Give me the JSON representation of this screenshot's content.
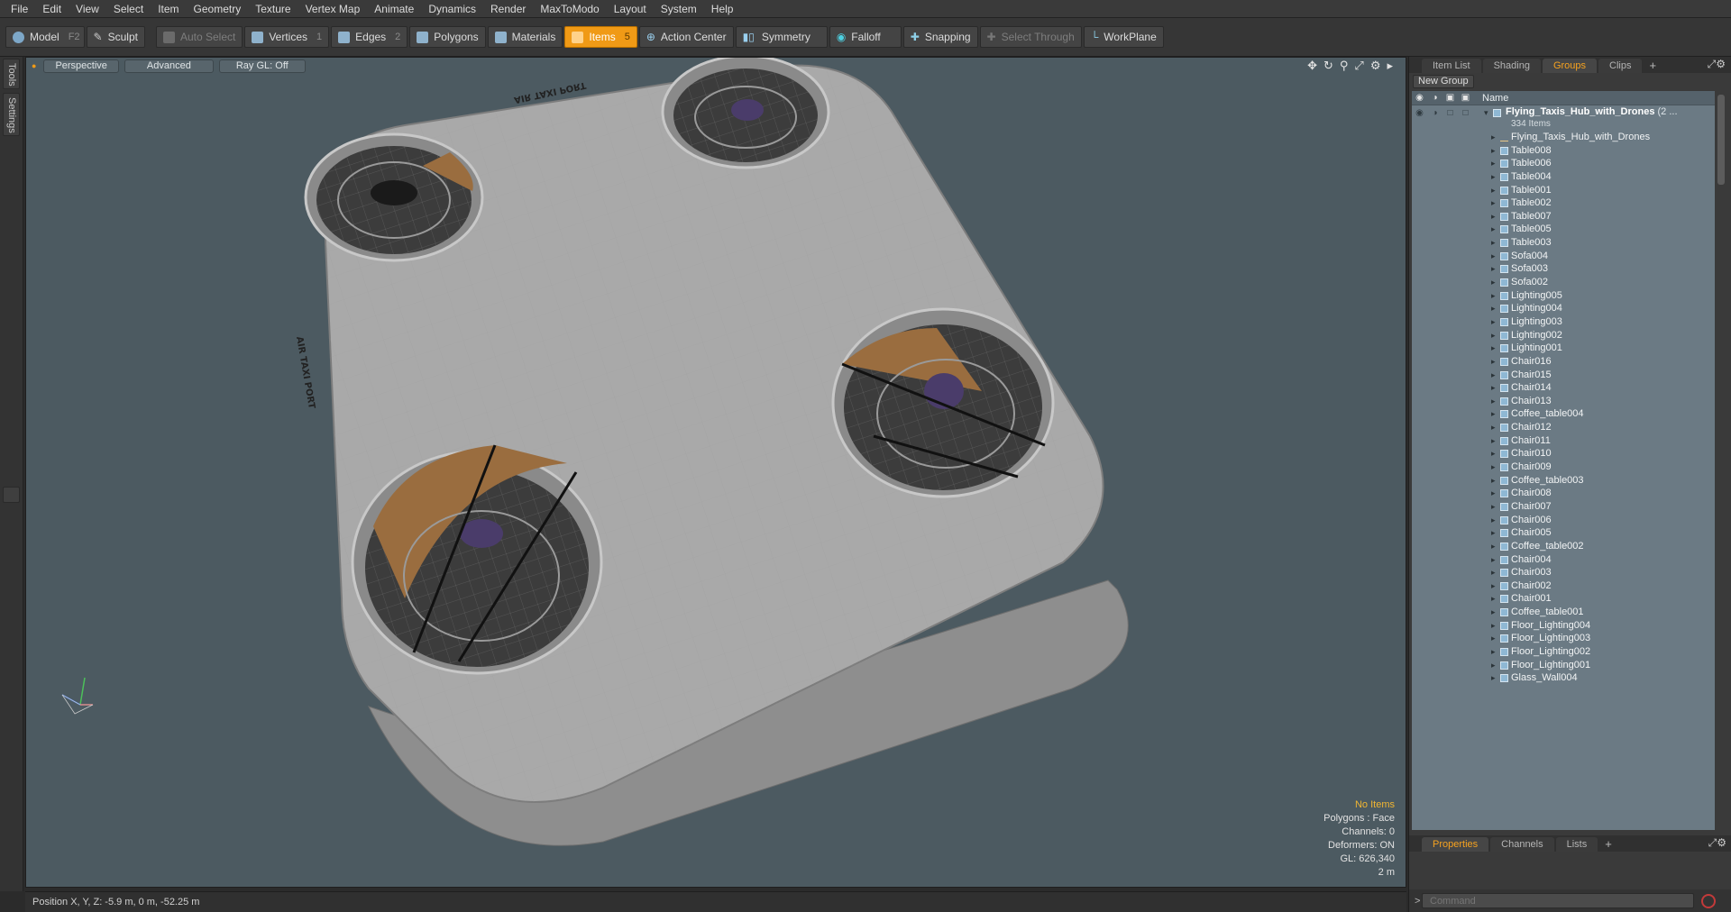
{
  "menu": [
    "File",
    "Edit",
    "View",
    "Select",
    "Item",
    "Geometry",
    "Texture",
    "Vertex Map",
    "Animate",
    "Dynamics",
    "Render",
    "MaxToModo",
    "Layout",
    "System",
    "Help"
  ],
  "toolbar": {
    "model": "Model",
    "model_key": "F2",
    "sculpt": "Sculpt",
    "auto_select": "Auto Select",
    "vertices": "Vertices",
    "vertices_key": "1",
    "edges": "Edges",
    "edges_key": "2",
    "polygons": "Polygons",
    "materials": "Materials",
    "items": "Items",
    "items_key": "5",
    "action_center": "Action Center",
    "symmetry": "Symmetry",
    "falloff": "Falloff",
    "snapping": "Snapping",
    "select_through": "Select Through",
    "workplane": "WorkPlane",
    "accent_color": "#f09a16"
  },
  "left_tabs": [
    "Tools",
    "Settings"
  ],
  "viewport": {
    "perspective": "Perspective",
    "advanced": "Advanced",
    "raygl": "Ray GL: Off",
    "sign_top": "AIR TAXI PORT",
    "sign_left": "AIR TAXI PORT",
    "info": {
      "no_items": "No Items",
      "polygons": "Polygons : Face",
      "channels": "Channels: 0",
      "deformers": "Deformers: ON",
      "gl": "GL: 626,340",
      "scale": "2 m"
    },
    "background_color": "#4c5a61"
  },
  "status": {
    "position": "Position X, Y, Z:  -5.9 m, 0 m, -52.25 m"
  },
  "right_panel": {
    "tabs": [
      "Item List",
      "Shading",
      "Groups",
      "Clips"
    ],
    "active_tab": "Groups",
    "new_group": "New Group",
    "column_name": "Name",
    "group_name": "Flying_Taxis_Hub_with_Drones",
    "group_suffix": "(2 ...",
    "group_count": "334 Items",
    "items": [
      "Flying_Taxis_Hub_with_Drones",
      "Table008",
      "Table006",
      "Table004",
      "Table001",
      "Table002",
      "Table007",
      "Table005",
      "Table003",
      "Sofa004",
      "Sofa003",
      "Sofa002",
      "Lighting005",
      "Lighting004",
      "Lighting003",
      "Lighting002",
      "Lighting001",
      "Chair016",
      "Chair015",
      "Chair014",
      "Chair013",
      "Coffee_table004",
      "Chair012",
      "Chair011",
      "Chair010",
      "Chair009",
      "Coffee_table003",
      "Chair008",
      "Chair007",
      "Chair006",
      "Chair005",
      "Coffee_table002",
      "Chair004",
      "Chair003",
      "Chair002",
      "Chair001",
      "Coffee_table001",
      "Floor_Lighting004",
      "Floor_Lighting003",
      "Floor_Lighting002",
      "Floor_Lighting001",
      "Glass_Wall004"
    ],
    "bottom_tabs": [
      "Properties",
      "Channels",
      "Lists"
    ],
    "bottom_active": "Properties",
    "command_placeholder": "Command"
  }
}
